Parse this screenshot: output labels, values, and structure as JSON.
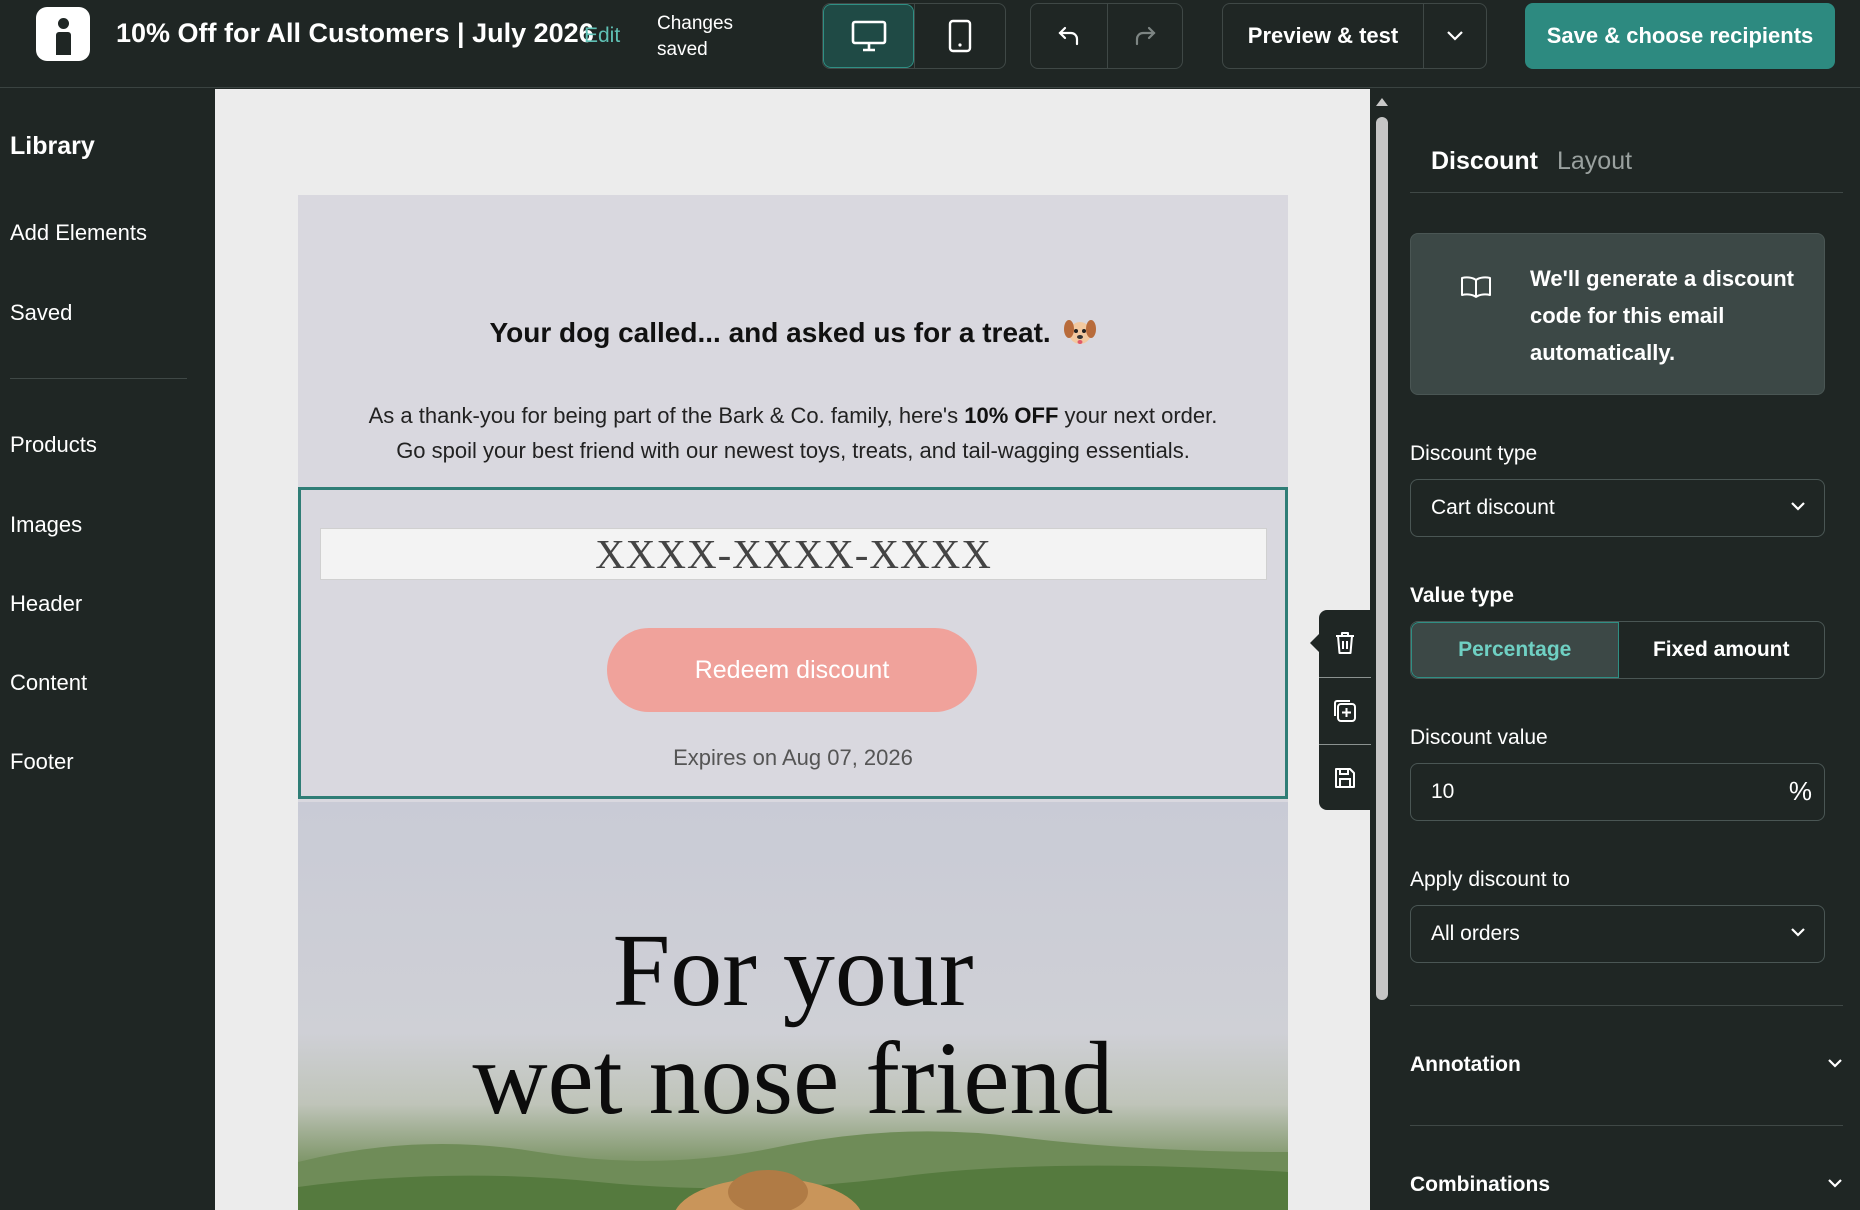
{
  "topbar": {
    "email_title": "10% Off for All Customers | July 2026",
    "edit_label": "Edit",
    "status_text": "Changes saved",
    "preview_label": "Preview & test",
    "save_label": "Save & choose recipients"
  },
  "sidebar": {
    "library_label": "Library",
    "items_top": [
      "Add Elements",
      "Saved"
    ],
    "items_bottom": [
      "Products",
      "Images",
      "Header",
      "Content",
      "Footer"
    ]
  },
  "email": {
    "headline": "Your dog called... and asked us for a treat.",
    "body_before_bold": "As a thank-you for being part of the Bark & Co. family, here's ",
    "body_bold": "10% OFF",
    "body_after_bold": " your next order.",
    "body_line2": "Go spoil your best friend with our newest toys, treats, and tail-wagging essentials.",
    "discount_code": "XXXX-XXXX-XXXX",
    "redeem_label": "Redeem discount",
    "expires_text": "Expires on Aug 07, 2026",
    "hero_line1": "For your",
    "hero_line2": "wet nose friend"
  },
  "panel": {
    "tabs": [
      "Discount",
      "Layout"
    ],
    "active_tab": "Discount",
    "info_text": "We'll generate a discount code for this email automatically.",
    "discount_type_label": "Discount type",
    "discount_type_value": "Cart discount",
    "value_type_label": "Value type",
    "value_type_options": [
      "Percentage",
      "Fixed amount"
    ],
    "value_type_selected": "Percentage",
    "discount_value_label": "Discount value",
    "discount_value": "10",
    "discount_value_suffix": "%",
    "apply_label": "Apply discount to",
    "apply_value": "All orders",
    "annotation_label": "Annotation",
    "combinations_label": "Combinations"
  },
  "icons": {
    "logo": "brand-logo-icon",
    "desktop": "desktop-icon",
    "mobile": "mobile-icon",
    "undo": "undo-icon",
    "redo": "redo-icon",
    "caret": "chevron-down-icon",
    "trash": "trash-icon",
    "duplicate": "duplicate-icon",
    "save_block": "save-block-icon",
    "book": "book-icon",
    "dog": "dog-face-icon"
  },
  "colors": {
    "accent": "#2d8a80",
    "accent_text": "#6fd0c3",
    "redeem_button": "#f0a29b",
    "selection_border": "#2f7d76",
    "dark_bg": "#1f2624"
  }
}
